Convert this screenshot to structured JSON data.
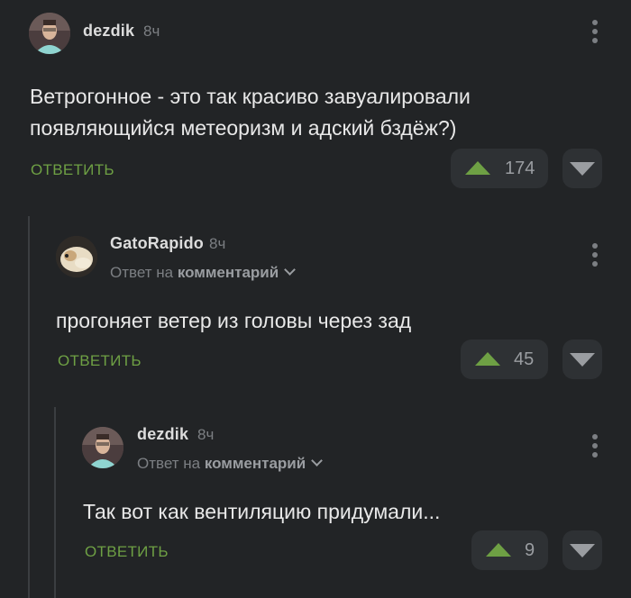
{
  "comments": [
    {
      "username": "dezdik",
      "time": "8ч",
      "text_lines": [
        "Ветрогонное - это так красиво завуалировали",
        "появляющийся метеоризм и адский бздёж?)"
      ],
      "reply_label": "ОТВЕТИТЬ",
      "votes": "174",
      "avatar_icon": "user-photo-avatar"
    },
    {
      "username": "GatoRapido",
      "time": "8ч",
      "reply_to_prefix": "Ответ на",
      "reply_to_target": "комментарий",
      "text_lines": [
        "прогоняет ветер из головы через зад"
      ],
      "reply_label": "ОТВЕТИТЬ",
      "votes": "45",
      "avatar_icon": "hamster-avatar"
    },
    {
      "username": "dezdik",
      "time": "8ч",
      "reply_to_prefix": "Ответ на",
      "reply_to_target": "комментарий",
      "text_lines": [
        "Так вот как вентиляцию придумали..."
      ],
      "reply_label": "ОТВЕТИТЬ",
      "votes": "9",
      "avatar_icon": "user-photo-avatar"
    }
  ],
  "colors": {
    "background": "#222426",
    "accent_green": "#6ea044",
    "muted": "#7c7f83",
    "vote_bg": "#2e3134"
  }
}
